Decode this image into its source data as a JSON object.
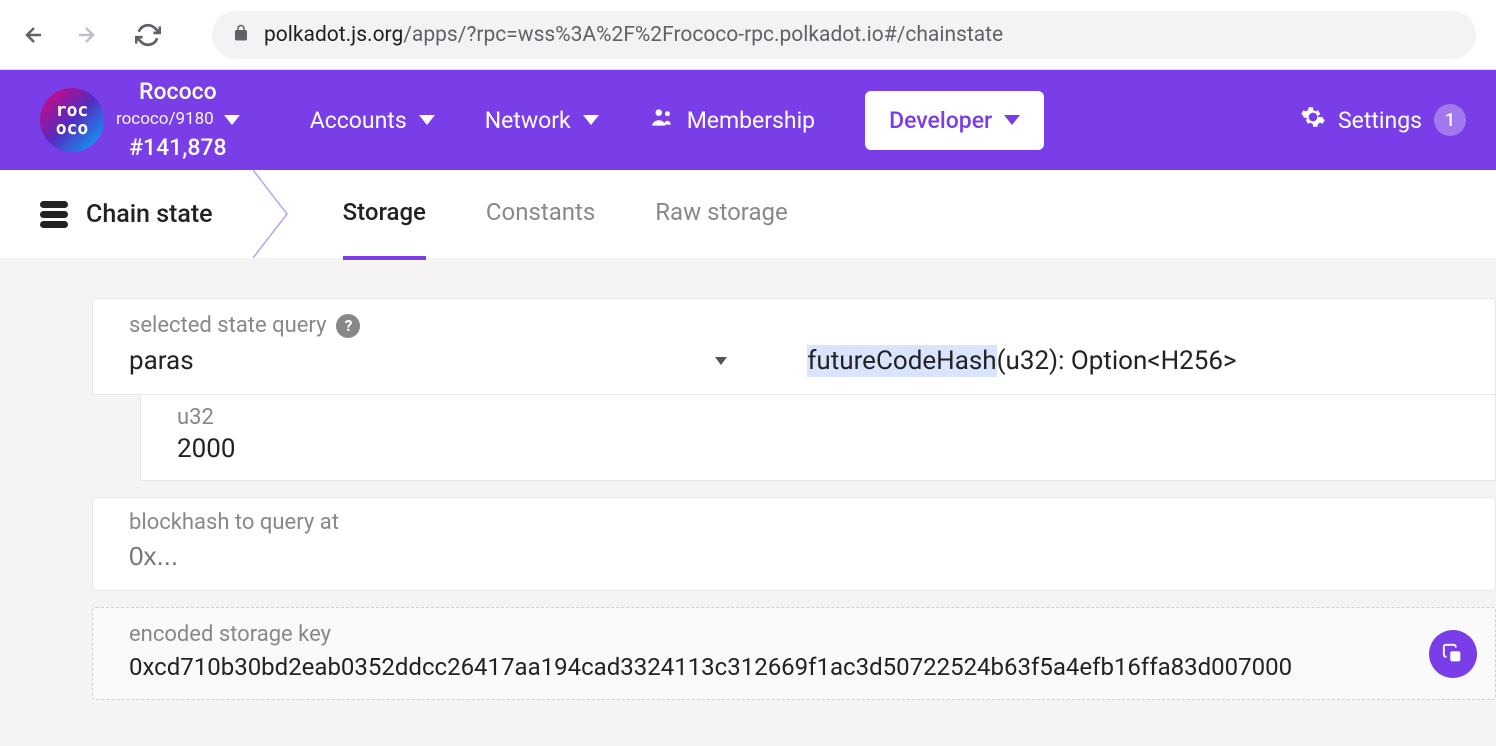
{
  "browser": {
    "url_domain": "polkadot.js.org",
    "url_path": "/apps/?rpc=wss%3A%2F%2Frococo-rpc.polkadot.io#/chainstate"
  },
  "header": {
    "logo_top": "roc",
    "logo_bottom": "oco",
    "chain_name": "Rococo",
    "chain_spec": "rococo/9180",
    "block_number": "#141,878",
    "nav": {
      "accounts": "Accounts",
      "network": "Network",
      "membership": "Membership",
      "developer": "Developer",
      "settings": "Settings",
      "settings_badge": "1"
    }
  },
  "subnav": {
    "title": "Chain state",
    "tabs": {
      "storage": "Storage",
      "constants": "Constants",
      "raw": "Raw storage"
    }
  },
  "query": {
    "label": "selected state query",
    "module": "paras",
    "method_name": "futureCodeHash",
    "method_sig": "(u32): Option<H256>"
  },
  "param": {
    "type": "u32",
    "value": "2000"
  },
  "blockhash": {
    "label": "blockhash to query at",
    "placeholder": "0x..."
  },
  "encoded": {
    "label": "encoded storage key",
    "value": "0xcd710b30bd2eab0352ddcc26417aa194cad3324113c312669f1ac3d50722524b63f5a4efb16ffa83d007000"
  }
}
